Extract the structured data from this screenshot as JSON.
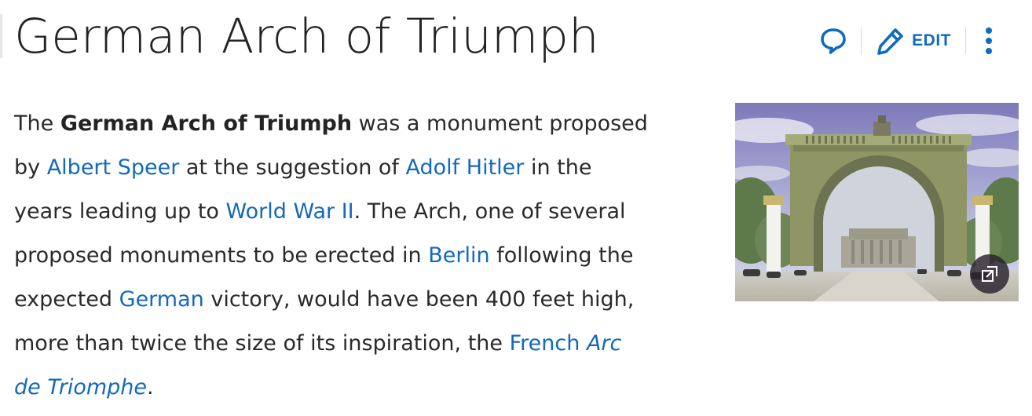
{
  "page": {
    "title": "German Arch of Triumph"
  },
  "actions": {
    "talk_icon": "speech-bubble-icon",
    "edit_label": "EDIT",
    "edit_icon": "pencil-icon",
    "more_icon": "vertical-ellipsis-icon",
    "accent_color": "#0f6bbf"
  },
  "lead": {
    "text_1": "The ",
    "bold_title": "German Arch of Triumph",
    "text_2": " was a monument proposed",
    "text_3": "by ",
    "link_speer": "Albert Speer",
    "text_4": " at the suggestion of ",
    "link_hitler": "Adolf Hitler",
    "text_5": " in the",
    "text_6": "years leading up to ",
    "link_ww2": "World War II",
    "text_7": ". The Arch, one of several",
    "text_8": "proposed monuments to be erected in ",
    "link_berlin": "Berlin",
    "text_9": " following the",
    "text_10": "expected ",
    "link_german": "German",
    "text_11": " victory, would have been 400 feet high,",
    "text_12": "more than twice the size of its inspiration, the ",
    "link_french": "French",
    "link_arc_part1": "Arc",
    "link_arc_part2": "de Triomphe",
    "text_13": ".",
    "link_color": "#1469b9"
  },
  "image": {
    "subject": "arch-illustration",
    "expand_icon": "expand-icon"
  }
}
